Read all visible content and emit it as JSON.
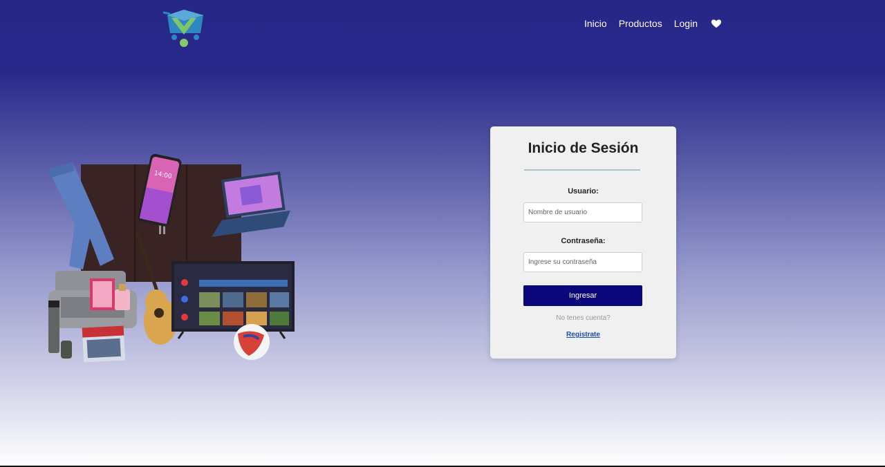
{
  "header": {
    "logo_icon": "shopping-cart-logo-icon",
    "nav": [
      {
        "label": "Inicio"
      },
      {
        "label": "Productos"
      },
      {
        "label": "Login"
      }
    ],
    "favorites_icon": "heart-icon"
  },
  "hero": {
    "collage_icon": "products-collage-image"
  },
  "login": {
    "title": "Inicio de Sesión",
    "username_label": "Usuario:",
    "username_placeholder": "Nombre de usuario",
    "username_value": "",
    "password_label": "Contraseña:",
    "password_placeholder": "Ingrese su contraseña",
    "password_value": "",
    "submit_label": "Ingresar",
    "no_account_text": "No tenes cuenta?",
    "register_label": "Registrate"
  },
  "colors": {
    "header_bg": "#272788",
    "submit_bg": "#0a087a",
    "link": "#1b4db3"
  }
}
